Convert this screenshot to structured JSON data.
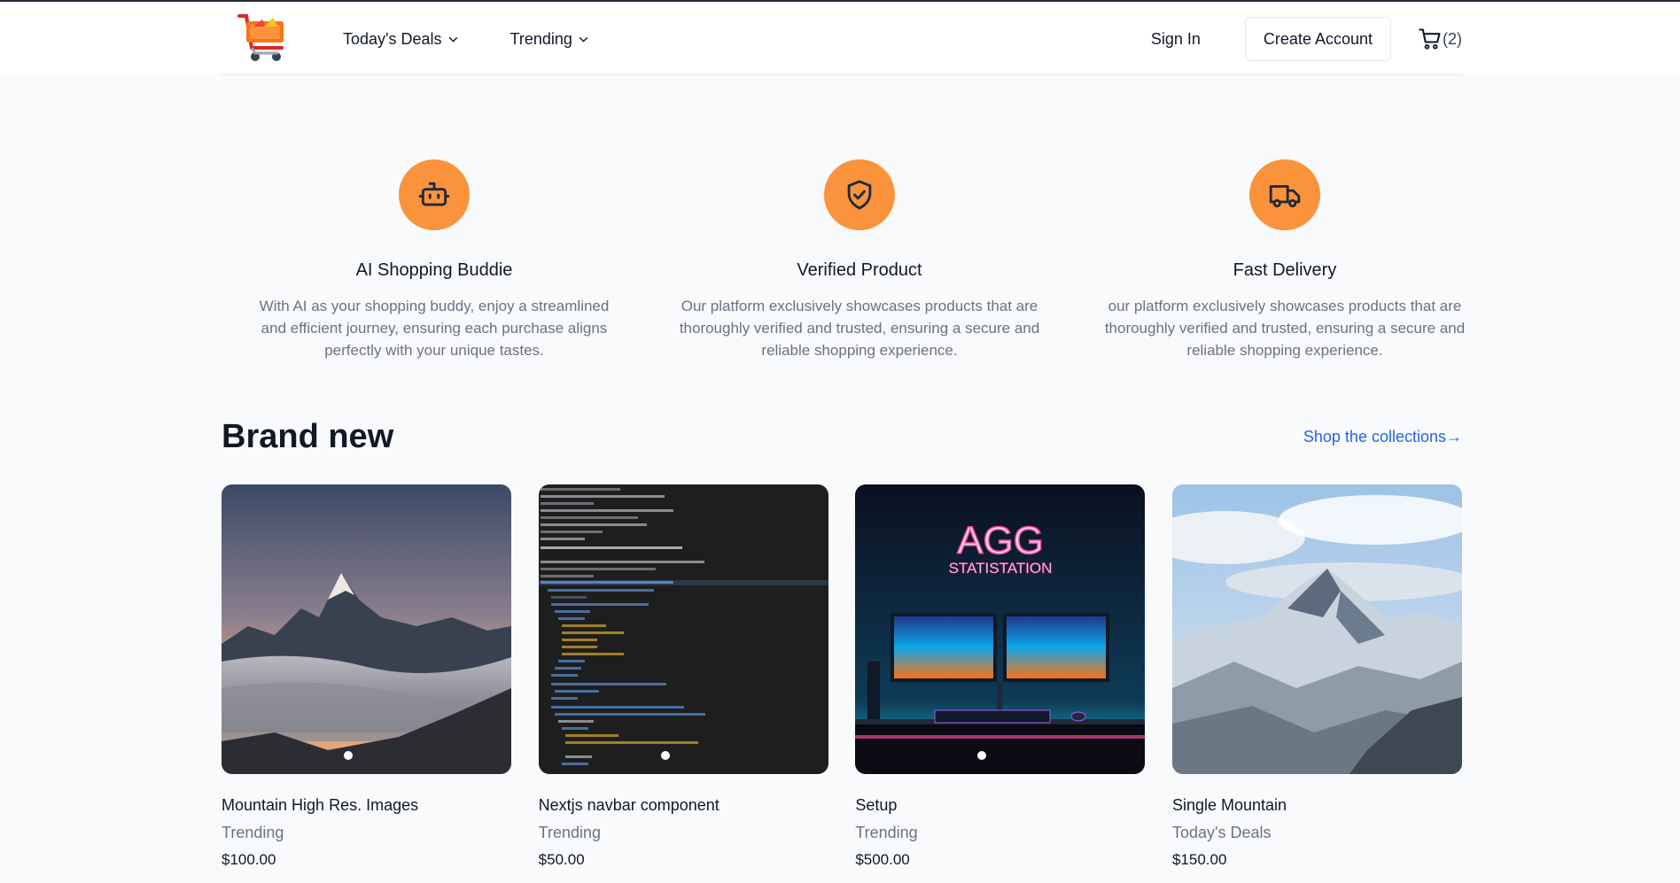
{
  "header": {
    "nav": [
      {
        "label": "Today's Deals"
      },
      {
        "label": "Trending"
      }
    ],
    "sign_in": "Sign In",
    "create_account": "Create Account",
    "cart_count": "(2)"
  },
  "features": [
    {
      "icon": "bot-icon",
      "title": "AI Shopping Buddie",
      "desc": "With AI as your shopping buddy, enjoy a streamlined and efficient journey, ensuring each purchase aligns perfectly with your unique tastes."
    },
    {
      "icon": "shield-check-icon",
      "title": "Verified Product",
      "desc": "Our platform exclusively showcases products that are thoroughly verified and trusted, ensuring a secure and reliable shopping experience."
    },
    {
      "icon": "truck-icon",
      "title": "Fast Delivery",
      "desc": "our platform exclusively showcases products that are thoroughly verified and trusted, ensuring a secure and reliable shopping experience."
    }
  ],
  "brand_new": {
    "title": "Brand new",
    "link": "Shop the collections→"
  },
  "products": [
    {
      "name": "Mountain High Res. Images",
      "category": "Trending",
      "price": "$100.00"
    },
    {
      "name": "Nextjs navbar component",
      "category": "Trending",
      "price": "$50.00"
    },
    {
      "name": "Setup",
      "category": "Trending",
      "price": "$500.00",
      "image_text": [
        "AGG",
        "STATISTATION"
      ]
    },
    {
      "name": "Single Mountain",
      "category": "Today's Deals",
      "price": "$150.00"
    }
  ],
  "colors": {
    "accent": "#fb923c",
    "link": "#2563eb"
  }
}
